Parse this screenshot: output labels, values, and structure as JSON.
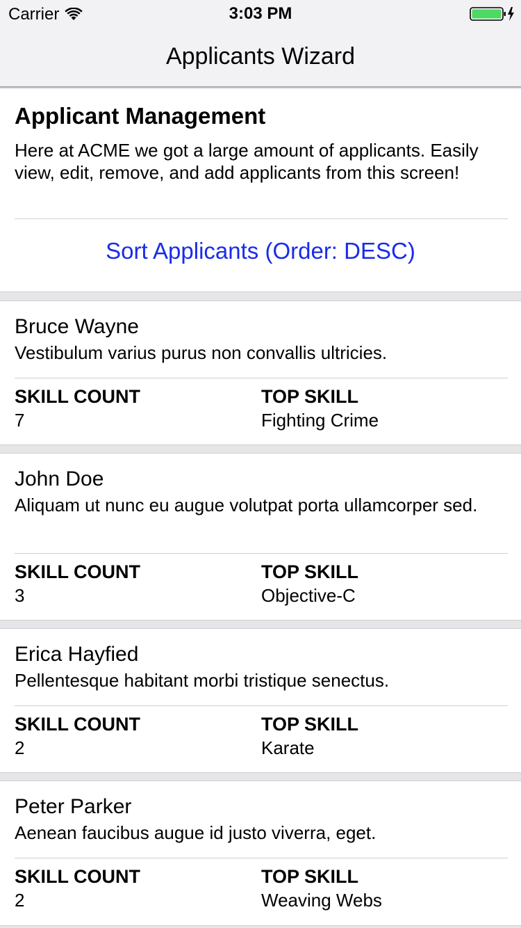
{
  "status_bar": {
    "carrier": "Carrier",
    "time": "3:03 PM",
    "battery_color": "#4cd964"
  },
  "nav": {
    "title": "Applicants Wizard"
  },
  "header": {
    "title": "Applicant Management",
    "description": "Here at ACME we got a large amount of applicants. Easily view, edit, remove, and add applicants from this screen!",
    "sort_label": "Sort Applicants (Order: DESC)",
    "accent_color": "#1a2ce8"
  },
  "labels": {
    "skill_count": "SKILL COUNT",
    "top_skill": "TOP SKILL"
  },
  "applicants": [
    {
      "name": "Bruce Wayne",
      "description": "Vestibulum varius purus non convallis ultricies.",
      "skill_count": "7",
      "top_skill": "Fighting Crime"
    },
    {
      "name": "John Doe",
      "description": "Aliquam ut nunc eu augue volutpat porta ullamcorper sed.",
      "skill_count": "3",
      "top_skill": "Objective-C"
    },
    {
      "name": "Erica Hayfied",
      "description": "Pellentesque habitant morbi tristique senectus.",
      "skill_count": "2",
      "top_skill": "Karate"
    },
    {
      "name": "Peter Parker",
      "description": "Aenean faucibus augue id justo viverra, eget.",
      "skill_count": "2",
      "top_skill": "Weaving Webs"
    }
  ]
}
